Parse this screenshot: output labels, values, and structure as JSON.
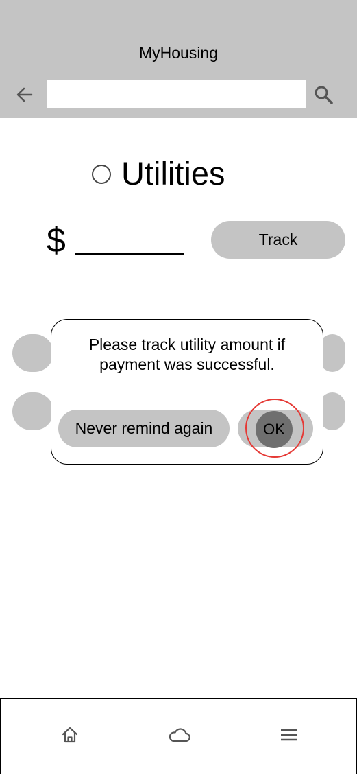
{
  "header": {
    "title": "MyHousing",
    "search_value": "",
    "back_icon": "arrow-left-icon",
    "search_icon": "magnifier-icon"
  },
  "utility": {
    "label": "Utilities"
  },
  "amount": {
    "currency": "$"
  },
  "track_label": "Track",
  "dialog": {
    "message": "Please track utility amount if payment was successful.",
    "never_label": "Never remind again",
    "ok_label": "OK"
  },
  "bottom_nav": {
    "items": [
      "home-icon",
      "cloud-icon",
      "menu-icon"
    ]
  },
  "colors": {
    "header_bg": "#c4c4c4",
    "button_bg": "#c4c4c4",
    "ok_bg": "#6f6f6f",
    "highlight": "#e53935"
  }
}
